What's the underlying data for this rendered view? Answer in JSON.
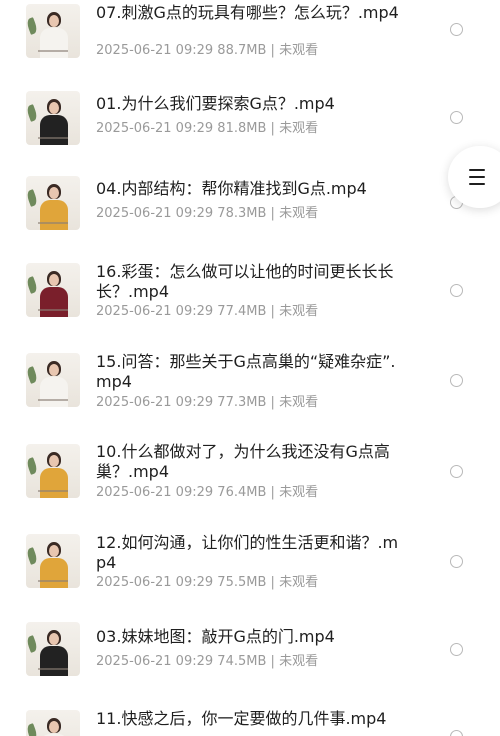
{
  "videos": [
    {
      "title": "07.刺激G点的玩具有哪些？怎么玩？.mp4",
      "date": "2025-06-21 09:29",
      "size": "88.7MB",
      "status": "未观看",
      "shirt_color": "#f5f3ef"
    },
    {
      "title": "01.为什么我们要探索G点？.mp4",
      "date": "2025-06-21 09:29",
      "size": "81.8MB",
      "status": "未观看",
      "shirt_color": "#222222"
    },
    {
      "title": "04.内部结构：帮你精准找到G点.mp4",
      "date": "2025-06-21 09:29",
      "size": "78.3MB",
      "status": "未观看",
      "shirt_color": "#e0a53a"
    },
    {
      "title": "16.彩蛋：怎么做可以让他的时间更长长长长？.mp4",
      "date": "2025-06-21 09:29",
      "size": "77.4MB",
      "status": "未观看",
      "shirt_color": "#7a1f2b"
    },
    {
      "title": "15.问答：那些关于G点高巢的“疑难杂症”.mp4",
      "date": "2025-06-21 09:29",
      "size": "77.3MB",
      "status": "未观看",
      "shirt_color": "#f5f3ef"
    },
    {
      "title": "10.什么都做对了，为什么我还没有G点高巢？.mp4",
      "date": "2025-06-21 09:29",
      "size": "76.4MB",
      "status": "未观看",
      "shirt_color": "#e0a53a"
    },
    {
      "title": "12.如何沟通，让你们的性生活更和谐？.mp4",
      "date": "2025-06-21 09:29",
      "size": "75.5MB",
      "status": "未观看",
      "shirt_color": "#e0a53a"
    },
    {
      "title": "03.妹妹地图：敲开G点的门.mp4",
      "date": "2025-06-21 09:29",
      "size": "74.5MB",
      "status": "未观看",
      "shirt_color": "#222222"
    },
    {
      "title": "11.快感之后，你一定要做的几件事.mp4",
      "date": "",
      "size": "",
      "status": "",
      "shirt_color": "#f5f3ef"
    }
  ],
  "separator": "|",
  "menu_icon": "hamburger-menu-icon"
}
